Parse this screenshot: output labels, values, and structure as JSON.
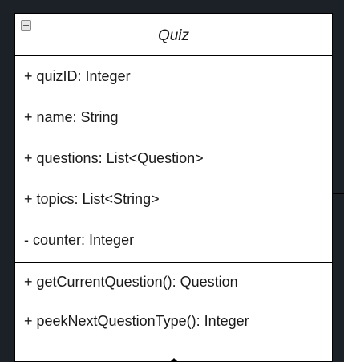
{
  "class": {
    "name": "Quiz",
    "attributes": [
      "+ quizID: Integer",
      "+ name: String",
      "+ questions: List<Question>",
      "+ topics: List<String>",
      "- counter: Integer"
    ],
    "methods": [
      "+ getCurrentQuestion(): Question",
      "+ peekNextQuestionType():  Integer"
    ]
  },
  "icons": {
    "collapse": "collapse-minus-icon"
  },
  "colors": {
    "background": "#1c2128",
    "class_fill": "#ffffff",
    "border": "#000000",
    "text": "#1a1a1a"
  }
}
